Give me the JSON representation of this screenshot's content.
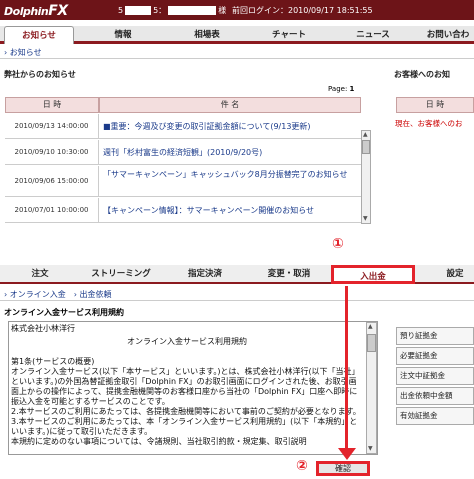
{
  "header": {
    "logo_prefix": "Dolphin",
    "logo_fx": "FX",
    "account_prefix": "5",
    "account_mid": "5：",
    "account_suffix": "様",
    "last_login": "前回ログイン：2010/09/17 18:51:55"
  },
  "top_tabs": [
    "お知らせ",
    "情報",
    "相場表",
    "チャート",
    "ニュース",
    "お問い合わ"
  ],
  "top_sub": "お知らせ",
  "company_news_title": "弊社からのお知らせ",
  "customer_news_title": "お客様へのお知",
  "page_label": "Page:",
  "page_num": "1",
  "table_headers": {
    "date": "日 時",
    "subject": "件 名"
  },
  "news": [
    {
      "date": "2010/09/13 14:00:00",
      "subject": "■重要：今週及び変更の取引証拠金額について(9/13更新)"
    },
    {
      "date": "2010/09/10 10:30:00",
      "subject": "週刊「杉村富生の経済短観」(2010/9/20号)"
    },
    {
      "date": "2010/09/06 15:00:00",
      "subject": "「サマーキャンペーン」キャッシュバック8月分振替完了のお知らせ"
    },
    {
      "date": "2010/07/01 10:00:00",
      "subject": "【キャンペーン情報】：サマーキャンペーン開催のお知らせ"
    }
  ],
  "right_header": "日 時",
  "right_notice": "現在、お客様へのお",
  "trade_tabs": [
    "注文",
    "ストリーミング",
    "指定決済",
    "変更・取消",
    "入出金",
    "設定"
  ],
  "trade_sub": [
    "オンライン入金",
    "出金依頼"
  ],
  "tos_title": "オンライン入金サービス利用規約",
  "tos_lines": [
    "株式会社小林洋行",
    "オンライン入金サービス利用規約",
    "",
    "第1条(サービスの概要)",
    "オンライン入金サービス(以下「本サービス」といいます。)とは、株式会社小林洋行(以下「当社」といいます。)の外国為替証拠金取引「Dolphin FX」のお取引画面にログインされた後、お取引画面上からの操作によって、提携金融機関等のお客様口座から当社の「Dolphin FX」口座へ即時に振込入金を可能とするサービスのことです。",
    "2.本サービスのご利用にあたっては、各提携金融機関等において事前のご契約が必要となります。",
    "3.本サービスのご利用にあたっては、本「オンライン入金サービス利用規約」(以下「本規約」といいます。)に従って取引いただきます。",
    "本規約に定めのない事項については、令諸規則、当社取引約款・規定集、取引説明"
  ],
  "side_buttons": [
    "預り証拠金",
    "必要証拠金",
    "注文中証拠金",
    "出金依頼中金額",
    "有効証拠金"
  ],
  "confirm_label": "確認",
  "marker1": "①",
  "marker2": "②",
  "accent": "#e3232b"
}
